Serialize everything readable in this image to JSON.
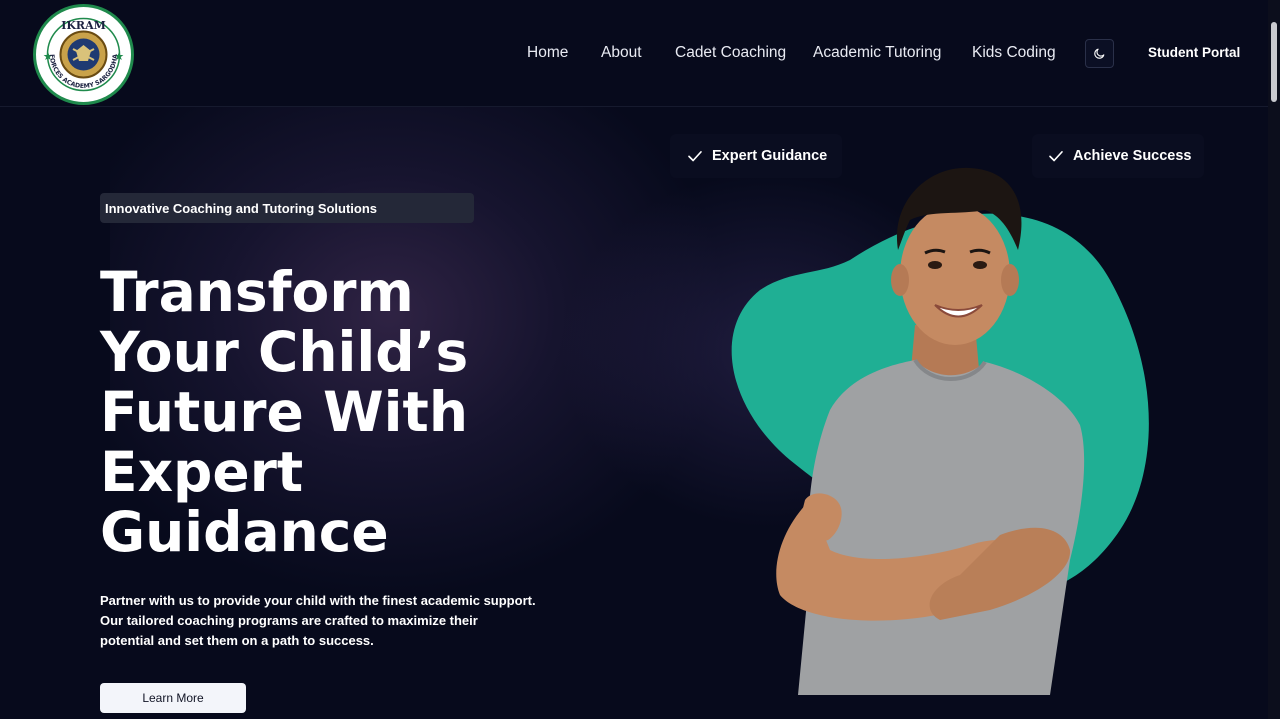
{
  "logo": {
    "top_text": "IKRAM",
    "ring_text": "FORCES ACADEMY SARGODHA"
  },
  "nav": {
    "items": [
      "Home",
      "About",
      "Cadet Coaching",
      "Academic Tutoring",
      "Kids Coding"
    ],
    "theme_icon": "moon-icon",
    "portal_label": "Student Portal"
  },
  "hero": {
    "badge": "Innovative Coaching and Tutoring Solutions",
    "headline_lines": [
      "Transform",
      "Your Child’s",
      "Future With",
      "Expert",
      "Guidance"
    ],
    "description_lines": [
      "Partner with us to provide your child with the finest academic support.",
      "Our tailored coaching programs are crafted to maximize their",
      "potential and set them on a path to success."
    ],
    "cta_label": "Learn More"
  },
  "features": [
    {
      "label": "Expert Guidance",
      "icon": "check-icon"
    },
    {
      "label": "Achieve Success",
      "icon": "check-icon"
    }
  ],
  "colors": {
    "background": "#070a1c",
    "accent_blob": "#1faf94",
    "shirt": "#9fa1a3",
    "skin": "#c58a62"
  }
}
